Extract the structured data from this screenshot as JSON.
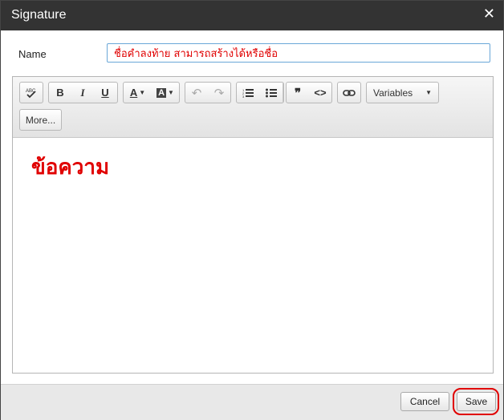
{
  "dialog": {
    "title": "Signature",
    "close_glyph": "✕"
  },
  "form": {
    "name_label": "Name",
    "name_value": "ชื่อคำลงท้าย สามารถสร้างได้หรือชื่อ"
  },
  "toolbar": {
    "spellcheck": "ABC✓",
    "bold": "B",
    "italic": "I",
    "underline": "U",
    "text_color": "A",
    "bg_color": "A",
    "undo": "↶",
    "redo": "↷",
    "ordered_list": "≡",
    "bullet_list": "•≡",
    "blockquote": "❞❞",
    "code": "<>",
    "link": "⛓",
    "variables_label": "Variables",
    "more_label": "More..."
  },
  "editor": {
    "content": "ข้อความ"
  },
  "footer": {
    "cancel_label": "Cancel",
    "save_label": "Save"
  },
  "colors": {
    "accent": "#e00000",
    "titlebar": "#333333",
    "input_border": "#6aa7d8"
  }
}
